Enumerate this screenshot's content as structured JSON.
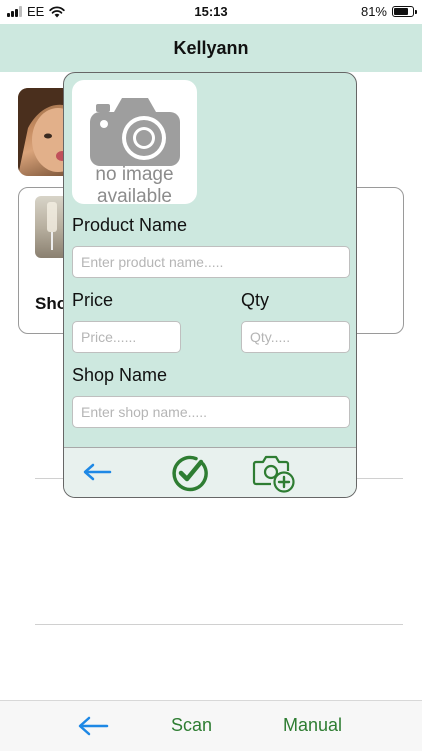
{
  "status_bar": {
    "carrier": "EE",
    "time": "15:13",
    "battery_text": "81%",
    "battery_level": 0.81
  },
  "nav": {
    "title": "Kellyann"
  },
  "background": {
    "card_label": "Sho"
  },
  "modal": {
    "no_image_line1": "no image",
    "no_image_line2": "available",
    "product_name_label": "Product Name",
    "product_name_placeholder": "Enter product name.....",
    "price_label": "Price",
    "price_placeholder": "Price......",
    "qty_label": "Qty",
    "qty_placeholder": "Qty.....",
    "shop_name_label": "Shop Name",
    "shop_name_placeholder": "Enter shop name.....",
    "footer": {
      "back_icon": "arrow-left-icon",
      "confirm_icon": "checkmark-circle-icon",
      "add_photo_icon": "add-photo-icon"
    }
  },
  "tab_bar": {
    "back_icon": "arrow-left-icon",
    "scan_label": "Scan",
    "manual_label": "Manual"
  },
  "colors": {
    "accent_green": "#2e7d32",
    "nav_bg": "#cde8df",
    "back_arrow_blue": "#1e88e5"
  }
}
